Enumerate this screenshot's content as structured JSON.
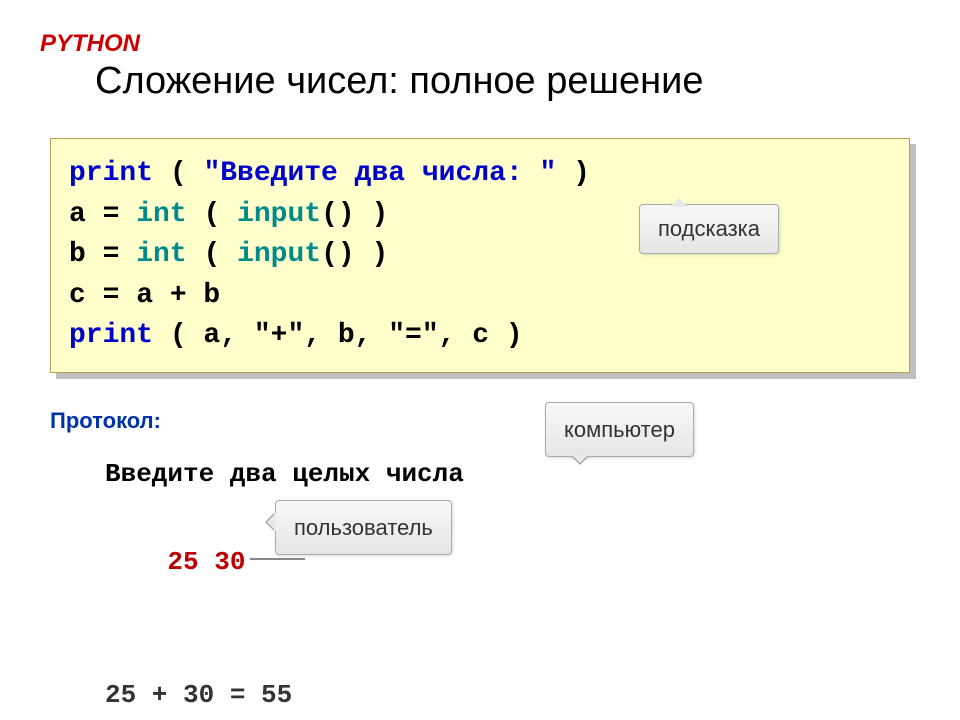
{
  "header": {
    "python": "PYTHON",
    "title": "Сложение чисел: полное решение"
  },
  "code": {
    "line1_print": "print",
    "line1_paren_o": " ( ",
    "line1_str": "\"Введите два числа: \"",
    "line1_paren_c": " )",
    "line2_pre": "a = ",
    "line2_int": "int",
    "line2_paren_o": " ( ",
    "line2_input": "input",
    "line2_paren_c": "() )",
    "line3_pre": "b = ",
    "line3_int": "int",
    "line3_paren_o": " ( ",
    "line3_input": "input",
    "line3_paren_c": "() )",
    "line4": "c = a + b",
    "line5_print": "print",
    "line5_tail": " ( a, \"+\", b, \"=\", c )"
  },
  "callouts": {
    "hint": "подсказка",
    "computer": "компьютер",
    "user": "пользователь"
  },
  "protocol": {
    "label": "Протокол:",
    "line1": "Введите два целых числа",
    "line2": "25 30",
    "line3": "25 + 30 = 55"
  }
}
